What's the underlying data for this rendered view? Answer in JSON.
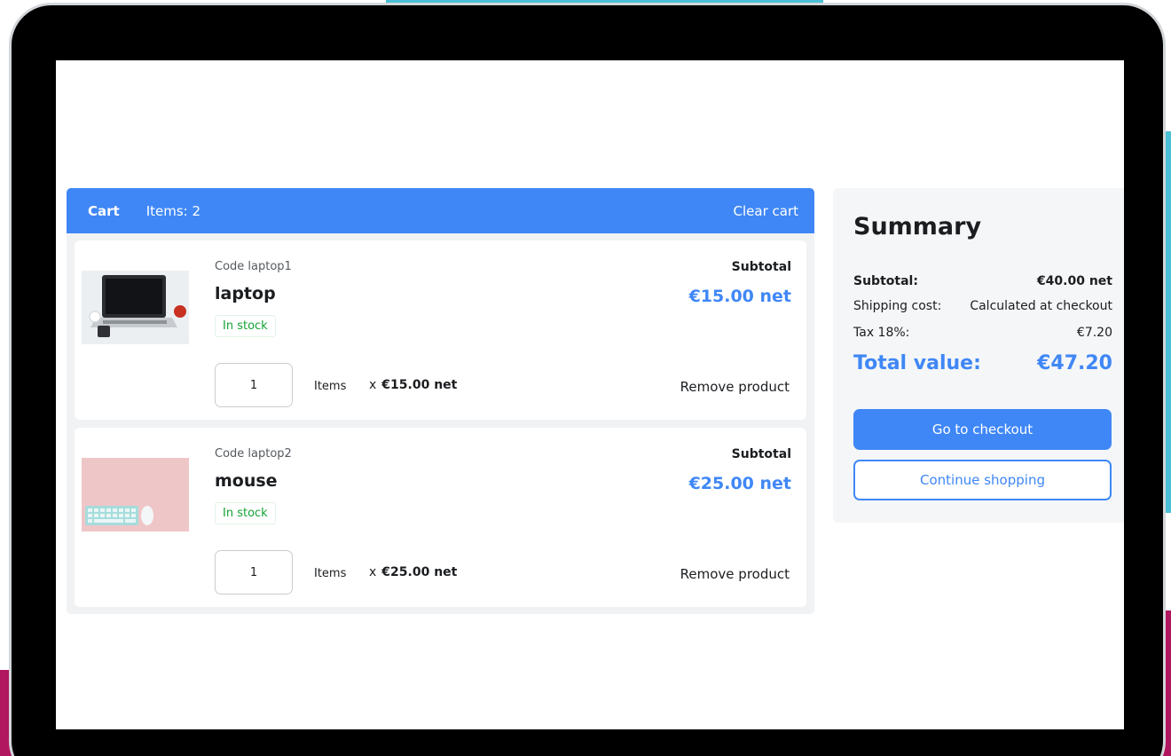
{
  "cart": {
    "title": "Cart",
    "items_count": "Items: 2",
    "clear_label": "Clear cart",
    "items": [
      {
        "code": "Code laptop1",
        "name": "laptop",
        "stock": "In stock",
        "subtotal_label": "Subtotal",
        "subtotal_value": "€15.00 net",
        "quantity": "1",
        "items_label": "Items",
        "multiplier": "x",
        "unit_price": "€15.00 net",
        "remove_label": "Remove product",
        "thumbnail_icon": "laptop-photo"
      },
      {
        "code": "Code laptop2",
        "name": "mouse",
        "stock": "In stock",
        "subtotal_label": "Subtotal",
        "subtotal_value": "€25.00 net",
        "quantity": "1",
        "items_label": "Items",
        "multiplier": "x",
        "unit_price": "€25.00 net",
        "remove_label": "Remove product",
        "thumbnail_icon": "keyboard-mouse-photo"
      }
    ]
  },
  "summary": {
    "title": "Summary",
    "subtotal_label": "Subtotal:",
    "subtotal_value": "€40.00 net",
    "shipping_label": "Shipping cost:",
    "shipping_value": "Calculated at checkout",
    "tax_label": "Tax 18%:",
    "tax_value": "€7.20",
    "total_label": "Total value:",
    "total_value": "€47.20",
    "checkout_label": "Go to checkout",
    "continue_label": "Continue shopping"
  },
  "colors": {
    "accent": "#3f87f6",
    "in_stock": "#15a336",
    "frame": "#000000",
    "decor_cyan": "#4bbfd6",
    "decor_magenta": "#b0175e"
  }
}
